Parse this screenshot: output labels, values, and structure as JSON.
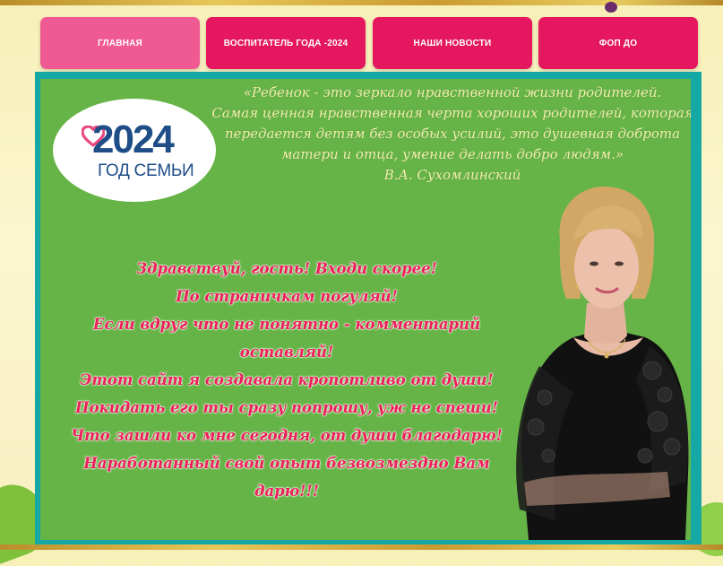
{
  "nav": {
    "items": [
      {
        "label": "ГЛАВНАЯ",
        "active": true
      },
      {
        "label": "ВОСПИТАТЕЛЬ ГОДА -2024",
        "active": false
      },
      {
        "label": "НАШИ НОВОСТИ",
        "active": false
      },
      {
        "label": "ФОП ДО",
        "active": false
      }
    ]
  },
  "logo": {
    "year": "2024",
    "subtitle": "ГОД СЕМЬИ",
    "icon": "heart-icon"
  },
  "quote": {
    "lines": [
      "«Ребенок - это зеркало нравственной жизни родителей.",
      "Самая ценная нравственная черта хороших родителей, которая",
      "передается детям без особых усилий, это душевная доброта",
      "матери и отца, умение делать добро людям.»"
    ],
    "author": "В.А. Сухомлинский"
  },
  "poem": {
    "lines": [
      "Здравствуй, гость! Входи скорее!",
      "По страничкам погуляй!",
      "Если вдруг что не понятно - комментарий",
      "оставляй!",
      "Этот сайт я создавала кропотливо от души!",
      "Покидать его ты сразу попрошу, уж не спеши!",
      "Что зашли ко мне сегодня, от души благодарю!",
      "Наработанный свой опыт безвозмездно Вам дарю!!!"
    ]
  },
  "colors": {
    "nav_active": "#f05a93",
    "nav_normal": "#e5175f",
    "panel_border": "#16a8a5",
    "panel_bg": "#66b447",
    "quote_text": "#f3eeb0",
    "poem_text": "#ec1f58",
    "logo_blue": "#1e4d87",
    "heart_pink": "#e8487f"
  }
}
